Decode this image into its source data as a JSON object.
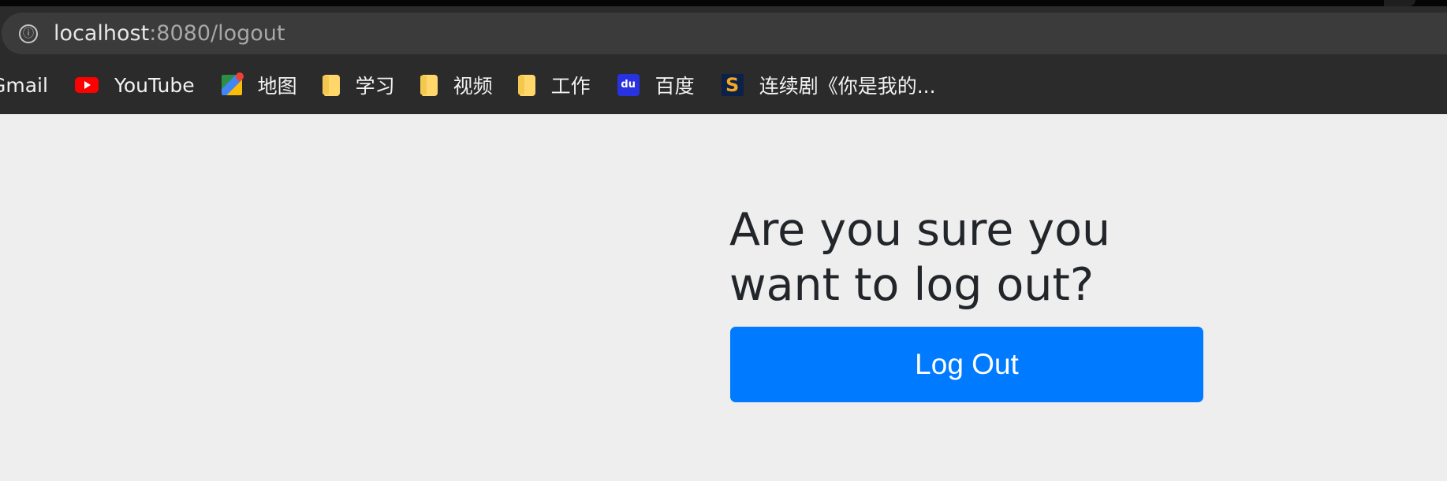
{
  "browser": {
    "address_bar": {
      "host": "localhost",
      "rest": ":8080/logout",
      "icon": "info-icon"
    },
    "bookmarks": [
      {
        "label": "Gmail",
        "icon": "none"
      },
      {
        "label": "YouTube",
        "icon": "youtube-icon"
      },
      {
        "label": "地图",
        "icon": "maps-icon"
      },
      {
        "label": "学习",
        "icon": "folder-icon"
      },
      {
        "label": "视频",
        "icon": "folder-icon"
      },
      {
        "label": "工作",
        "icon": "folder-icon"
      },
      {
        "label": "百度",
        "icon": "baidu-icon"
      },
      {
        "label": "连续剧《你是我的...",
        "icon": "s-icon"
      }
    ]
  },
  "page": {
    "title": "Are you sure you want to log out?",
    "button_label": "Log Out"
  },
  "colors": {
    "background": "#eeeeee",
    "button": "#007bff",
    "button_text": "#ffffff",
    "heading": "#222529",
    "browser_bar": "#2b2b2b"
  },
  "icons": {
    "info": "ⓘ",
    "baidu": "du",
    "series": "S"
  }
}
